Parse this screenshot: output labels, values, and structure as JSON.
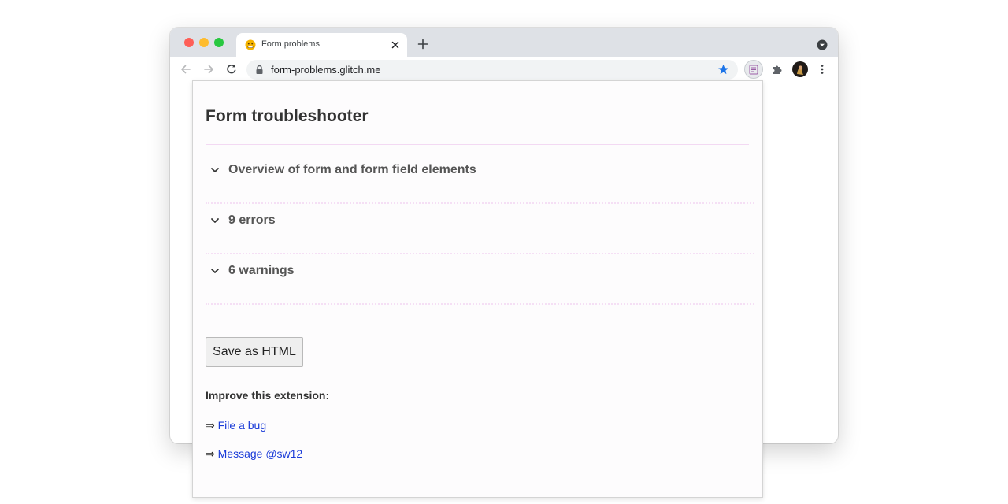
{
  "browser": {
    "tab": {
      "title": "Form problems",
      "favicon": "worried-face-emoji-icon"
    },
    "omnibox": {
      "url": "form-problems.glitch.me"
    },
    "colors": {
      "tabstrip": "#dee1e6",
      "bookmark_star": "#1a73e8"
    }
  },
  "popup": {
    "title": "Form troubleshooter",
    "sections": [
      {
        "label": "Overview of form and form field elements",
        "icon": "chevron-down-icon"
      },
      {
        "label": "9 errors",
        "icon": "chevron-down-icon"
      },
      {
        "label": "6 warnings",
        "icon": "chevron-down-icon"
      }
    ],
    "save_button": "Save as HTML",
    "improve_heading": "Improve this extension:",
    "links": [
      {
        "prefix": "⇒",
        "text": "File a bug"
      },
      {
        "prefix": "⇒",
        "text": "Message @sw12"
      }
    ],
    "colors": {
      "link": "#1a3bd8",
      "divider": "#f5dff5"
    }
  }
}
